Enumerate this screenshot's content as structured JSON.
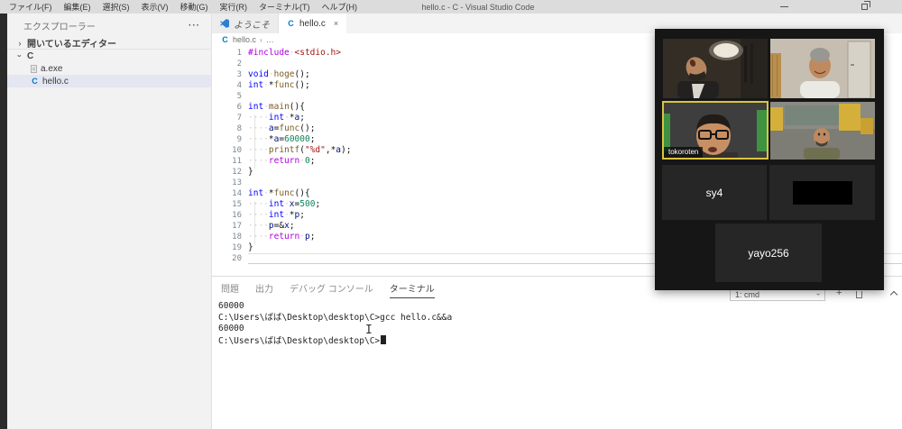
{
  "window": {
    "title": "hello.c - C - Visual Studio Code",
    "menu_items": [
      "ファイル(F)",
      "編集(E)",
      "選択(S)",
      "表示(V)",
      "移動(G)",
      "実行(R)",
      "ターミナル(T)",
      "ヘルプ(H)"
    ]
  },
  "icons": {
    "more_actions": "···",
    "chevron": "›",
    "close": "×",
    "add": "+",
    "breadcrumb_more": "…",
    "c_file": "C"
  },
  "sidebar": {
    "title": "エクスプローラー",
    "open_editors": "開いているエディター",
    "folder": "C",
    "files": [
      {
        "name": "a.exe",
        "selected": false
      },
      {
        "name": "hello.c",
        "selected": true
      }
    ]
  },
  "tabs": [
    {
      "label": "ようこそ",
      "active": false
    },
    {
      "label": "hello.c",
      "active": true
    }
  ],
  "breadcrumb": {
    "file": "hello.c"
  },
  "editor": {
    "current_line": 20,
    "code_lines": [
      [
        [
          "pre",
          "#include"
        ],
        [
          "pl",
          " "
        ],
        [
          "str",
          "<stdio.h>"
        ]
      ],
      [],
      [
        [
          "k",
          "void"
        ],
        [
          "pl",
          " "
        ],
        [
          "fn",
          "hoge"
        ],
        [
          "pl",
          "();"
        ]
      ],
      [
        [
          "k",
          "int"
        ],
        [
          "pl",
          " *"
        ],
        [
          "fn",
          "func"
        ],
        [
          "pl",
          "();"
        ]
      ],
      [],
      [
        [
          "k",
          "int"
        ],
        [
          "pl",
          " "
        ],
        [
          "fn",
          "main"
        ],
        [
          "pl",
          "(){"
        ]
      ],
      [
        [
          "pl",
          "    "
        ],
        [
          "k",
          "int"
        ],
        [
          "pl",
          " *"
        ],
        [
          "v",
          "a"
        ],
        [
          "pl",
          ";"
        ]
      ],
      [
        [
          "pl",
          "    "
        ],
        [
          "v",
          "a"
        ],
        [
          "pl",
          "="
        ],
        [
          "fn",
          "func"
        ],
        [
          "pl",
          "();"
        ]
      ],
      [
        [
          "pl",
          "    *"
        ],
        [
          "v",
          "a"
        ],
        [
          "pl",
          "="
        ],
        [
          "num",
          "60000"
        ],
        [
          "pl",
          ";"
        ]
      ],
      [
        [
          "pl",
          "    "
        ],
        [
          "fn",
          "printf"
        ],
        [
          "pl",
          "("
        ],
        [
          "str",
          "\"%d\""
        ],
        [
          "pl",
          ",*"
        ],
        [
          "v",
          "a"
        ],
        [
          "pl",
          ");"
        ]
      ],
      [
        [
          "pl",
          "    "
        ],
        [
          "ctl",
          "return"
        ],
        [
          "pl",
          " "
        ],
        [
          "num",
          "0"
        ],
        [
          "pl",
          ";"
        ]
      ],
      [
        [
          "pl",
          "}"
        ]
      ],
      [],
      [
        [
          "k",
          "int"
        ],
        [
          "pl",
          " *"
        ],
        [
          "fn",
          "func"
        ],
        [
          "pl",
          "(){"
        ]
      ],
      [
        [
          "pl",
          "    "
        ],
        [
          "k",
          "int"
        ],
        [
          "pl",
          " "
        ],
        [
          "v",
          "x"
        ],
        [
          "pl",
          "="
        ],
        [
          "num",
          "500"
        ],
        [
          "pl",
          ";"
        ]
      ],
      [
        [
          "pl",
          "    "
        ],
        [
          "k",
          "int"
        ],
        [
          "pl",
          " *"
        ],
        [
          "v",
          "p"
        ],
        [
          "pl",
          ";"
        ]
      ],
      [
        [
          "pl",
          "    "
        ],
        [
          "v",
          "p"
        ],
        [
          "pl",
          "=&"
        ],
        [
          "v",
          "x"
        ],
        [
          "pl",
          ";"
        ]
      ],
      [
        [
          "pl",
          "    "
        ],
        [
          "ctl",
          "return"
        ],
        [
          "pl",
          " "
        ],
        [
          "v",
          "p"
        ],
        [
          "pl",
          ";"
        ]
      ],
      [
        [
          "pl",
          "}"
        ]
      ],
      []
    ]
  },
  "panel": {
    "tabs": [
      "問題",
      "出力",
      "デバッグ コンソール",
      "ターミナル"
    ],
    "active_tab": "ターミナル",
    "shell_selector": "1: cmd",
    "terminal_lines": [
      "60000",
      "C:\\Users\\ばば\\Desktop\\desktop\\C>gcc hello.c&&a",
      "60000",
      "C:\\Users\\ばば\\Desktop\\desktop\\C>"
    ]
  },
  "call": {
    "participants": [
      {
        "label": "",
        "has_video": true
      },
      {
        "label": "",
        "has_video": true
      },
      {
        "label": "tokoroten",
        "has_video": true,
        "active_speaker": true
      },
      {
        "label": "",
        "has_video": true
      },
      {
        "label": "sy4",
        "has_video": false
      },
      {
        "label": "",
        "has_video": false,
        "redacted": true
      },
      {
        "label": "yayo256",
        "has_video": false
      }
    ]
  },
  "colors": {
    "accent_active_tile_border": "#d9c53f",
    "keyword": "#0000ff",
    "control_keyword": "#af00db",
    "function": "#795e26",
    "variable": "#001080",
    "number": "#098658",
    "string": "#a31515",
    "selected_row_bg": "#e4e6f1"
  }
}
